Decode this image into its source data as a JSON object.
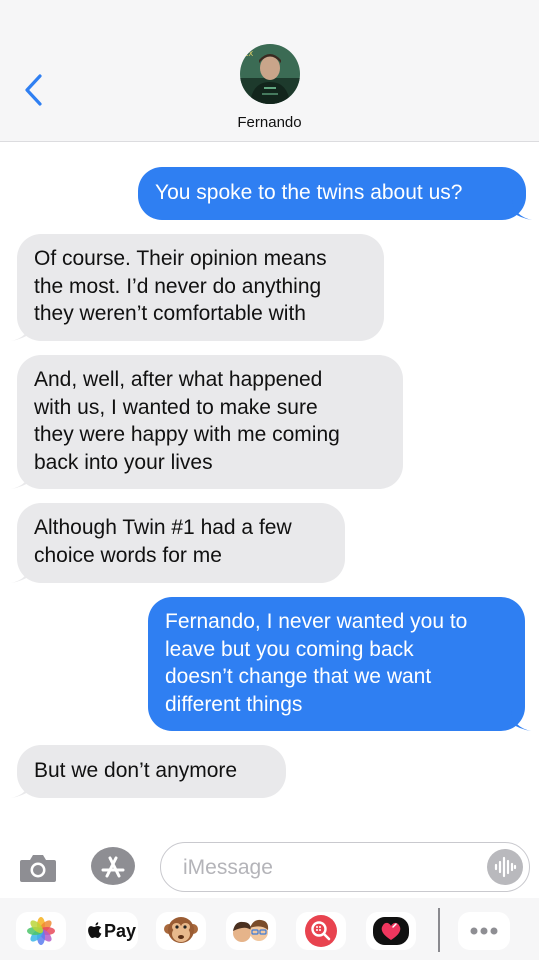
{
  "header": {
    "contact_name": "Fernando",
    "back_icon": "chevron-left-icon",
    "accent_color": "#2f7ff2"
  },
  "messages": [
    {
      "direction": "outgoing",
      "text": "You spoke to the twins about us?"
    },
    {
      "direction": "incoming",
      "lines": [
        "Of course. Their opinion means",
        "the most. I’d never do anything",
        "they weren’t comfortable with"
      ]
    },
    {
      "direction": "incoming",
      "lines": [
        "And, well, after what happened",
        "with us, I wanted to make sure",
        "they were happy with me coming",
        "back into your lives"
      ]
    },
    {
      "direction": "incoming",
      "lines": [
        "Although Twin #1 had a few",
        "choice words for me"
      ]
    },
    {
      "direction": "outgoing",
      "lines": [
        "Fernando, I never wanted you to",
        "leave but you coming back",
        "doesn’t change that we want",
        "different things"
      ]
    },
    {
      "direction": "incoming",
      "text": "But we don’t anymore"
    }
  ],
  "composer": {
    "placeholder": "iMessage",
    "camera_icon": "camera-icon",
    "appstore_icon": "app-store-icon",
    "audio_icon": "audio-waveform-icon"
  },
  "app_drawer": {
    "items": [
      {
        "icon": "photos-icon"
      },
      {
        "icon": "apple-pay-icon",
        "label": "Pay"
      },
      {
        "icon": "animoji-monkey-icon"
      },
      {
        "icon": "memoji-icon"
      },
      {
        "icon": "web-image-search-icon"
      },
      {
        "icon": "digital-touch-heart-icon"
      },
      {
        "icon": "more-apps-icon"
      }
    ]
  }
}
